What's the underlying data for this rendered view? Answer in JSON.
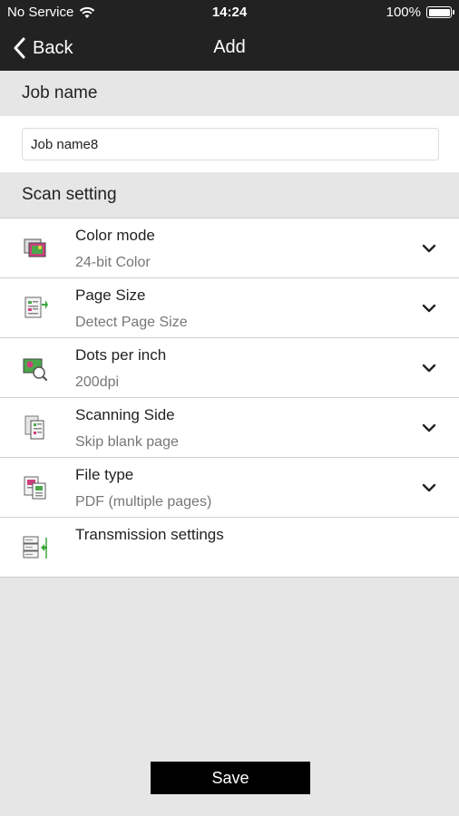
{
  "status_bar": {
    "carrier": "No Service",
    "time": "14:24",
    "battery": "100%",
    "battery_level": 1.0
  },
  "nav": {
    "back_label": "Back",
    "title": "Add"
  },
  "job_name": {
    "section_label": "Job name",
    "value": "Job name8"
  },
  "scan_setting": {
    "section_label": "Scan setting",
    "items": [
      {
        "title": "Color mode",
        "value": "24-bit Color",
        "icon": "color-mode-icon"
      },
      {
        "title": "Page Size",
        "value": "Detect Page Size",
        "icon": "page-size-icon"
      },
      {
        "title": "Dots per inch",
        "value": "200dpi",
        "icon": "dpi-icon"
      },
      {
        "title": "Scanning Side",
        "value": "Skip blank page",
        "icon": "scanning-side-icon"
      },
      {
        "title": "File type",
        "value": "PDF (multiple pages)",
        "icon": "file-type-icon"
      },
      {
        "title": "Transmission settings",
        "value": "",
        "icon": "transmission-icon"
      }
    ]
  },
  "footer": {
    "save_label": "Save"
  }
}
